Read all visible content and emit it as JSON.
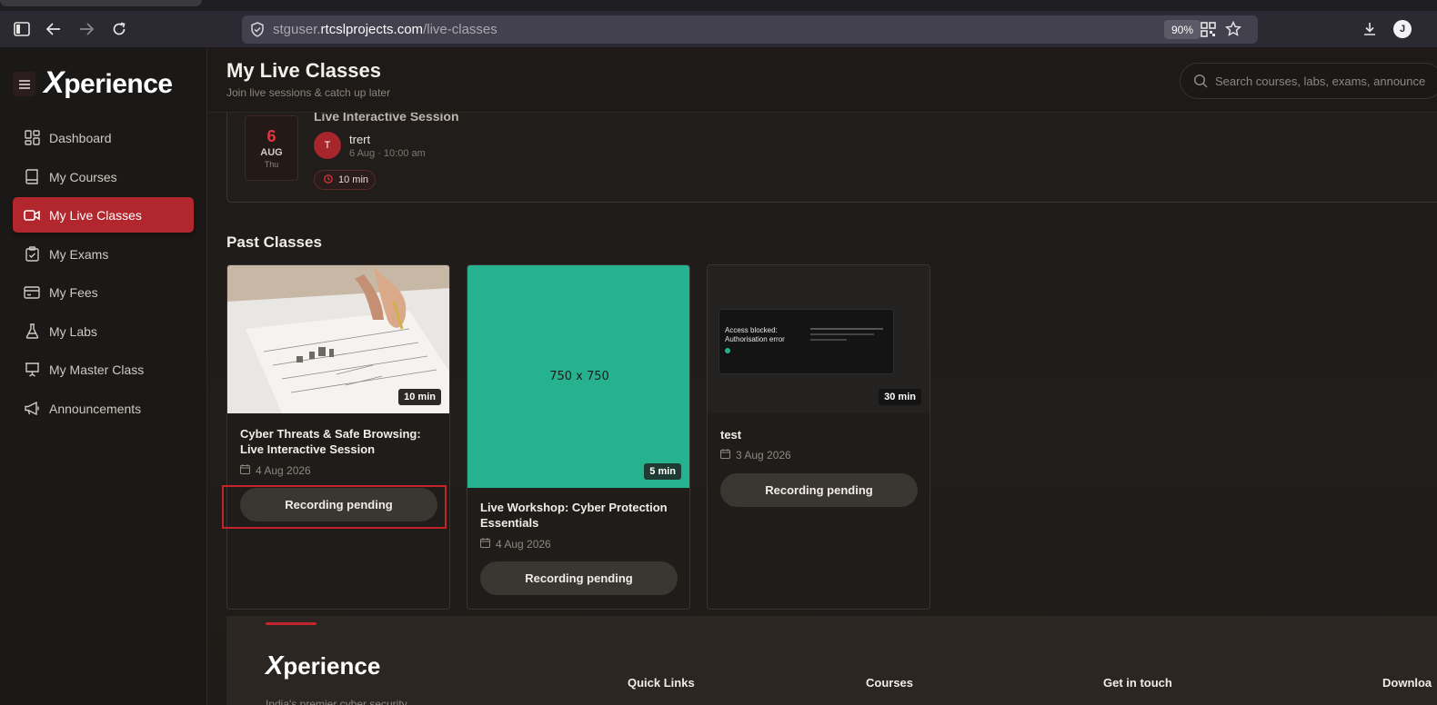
{
  "browser": {
    "url_host": "stguser.rtcslprojects.com",
    "url_path": "/live-classes",
    "url_prefix": "stguser.",
    "url_domain": "rtcslprojects.com",
    "zoom": "90%",
    "profile_initial": "J"
  },
  "sidebar": {
    "logo_x": "X",
    "logo_rest": "perience",
    "items": [
      {
        "label": "Dashboard",
        "icon": "dashboard-icon"
      },
      {
        "label": "My Courses",
        "icon": "book-icon"
      },
      {
        "label": "My Live Classes",
        "icon": "video-icon",
        "active": true
      },
      {
        "label": "My Exams",
        "icon": "clipboard-icon"
      },
      {
        "label": "My Fees",
        "icon": "credit-card-icon"
      },
      {
        "label": "My Labs",
        "icon": "flask-icon"
      },
      {
        "label": "My Master Class",
        "icon": "presentation-icon"
      },
      {
        "label": "Announcements",
        "icon": "megaphone-icon"
      }
    ]
  },
  "header": {
    "title": "My Live Classes",
    "subtitle": "Join live sessions & catch up later",
    "search_placeholder": "Search courses, labs, exams, announce"
  },
  "upcoming": {
    "day": "6",
    "month": "AUG",
    "weekday": "Thu",
    "title": "Live Interactive Session",
    "host_initial": "T",
    "host_name": "trert",
    "time": "6 Aug · 10:00 am",
    "duration": "10 min"
  },
  "past": {
    "section_title": "Past Classes",
    "cards": [
      {
        "title": "Cyber Threats & Safe Browsing: Live Interactive Session",
        "date": "4 Aug 2026",
        "duration": "10 min",
        "button": "Recording pending"
      },
      {
        "title": "Live Workshop: Cyber Protection Essentials",
        "date": "4 Aug 2026",
        "duration": "5 min",
        "button": "Recording pending",
        "placeholder": "750 x 750"
      },
      {
        "title": "test",
        "date": "3 Aug 2026",
        "duration": "30 min",
        "button": "Recording pending",
        "thumb_text_1": "Access blocked:",
        "thumb_text_2": "Authorisation error"
      }
    ]
  },
  "footer": {
    "logo_x": "X",
    "logo_rest": "perience",
    "columns": [
      "Quick Links",
      "Courses",
      "Get in touch",
      "Downloa"
    ],
    "tagline": "India's premier cyber security"
  },
  "colors": {
    "accent": "#b2262d",
    "teal": "#26b28f"
  }
}
